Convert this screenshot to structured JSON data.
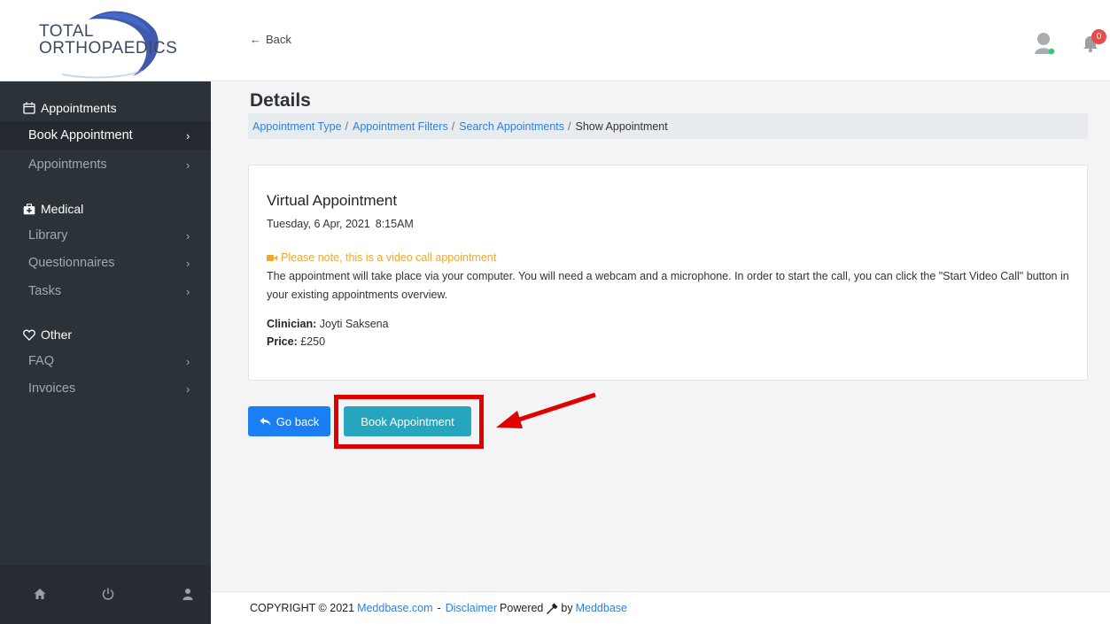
{
  "header": {
    "logo_text_line1": "TOTAL",
    "logo_text_line2": "ORTHOPAEDICS",
    "back_label": "Back",
    "notification_count": "0"
  },
  "sidebar": {
    "groups": [
      {
        "label": "Appointments",
        "icon": "calendar-icon"
      },
      {
        "label": "Medical",
        "icon": "medkit-icon"
      },
      {
        "label": "Other",
        "icon": "heart-icon"
      }
    ],
    "items": [
      {
        "label": "Book Appointment",
        "active": true
      },
      {
        "label": "Appointments"
      },
      {
        "label": "Library"
      },
      {
        "label": "Questionnaires"
      },
      {
        "label": "Tasks"
      },
      {
        "label": "FAQ"
      },
      {
        "label": "Invoices"
      }
    ],
    "chevron": "›",
    "footer_icons": [
      "home-icon",
      "power-icon",
      "user-icon"
    ]
  },
  "page": {
    "title": "Details",
    "breadcrumb": [
      "Appointment Type",
      "Appointment Filters",
      "Search Appointments",
      "Show Appointment"
    ],
    "separator": "/"
  },
  "card": {
    "title": "Virtual Appointment",
    "date": "Tuesday, 6 Apr, 2021",
    "time": "8:15AM",
    "note": "Please note, this is a video call appointment",
    "description": "The appointment will take place via your computer. You will need a webcam and a microphone. In order to start the call, you can click the \"Start Video Call\" button in your existing appointments overview.",
    "clinician_label": "Clinician:",
    "clinician_value": "Joyti Saksena",
    "price_label": "Price:",
    "price_value": "£250"
  },
  "buttons": {
    "go_back": "Go back",
    "book": "Book Appointment"
  },
  "footer": {
    "copyright": "COPYRIGHT © 2021",
    "link1": "Meddbase.com",
    "dash": "-",
    "link2": "Disclaimer",
    "powered": "Powered",
    "by": "by",
    "link3": "Meddbase"
  },
  "colors": {
    "sidebar_bg": "#2b3238",
    "primary_blue": "#1a7ef5",
    "teal": "#25a6be",
    "warning": "#f0a630",
    "annotation_red": "#e00000"
  }
}
